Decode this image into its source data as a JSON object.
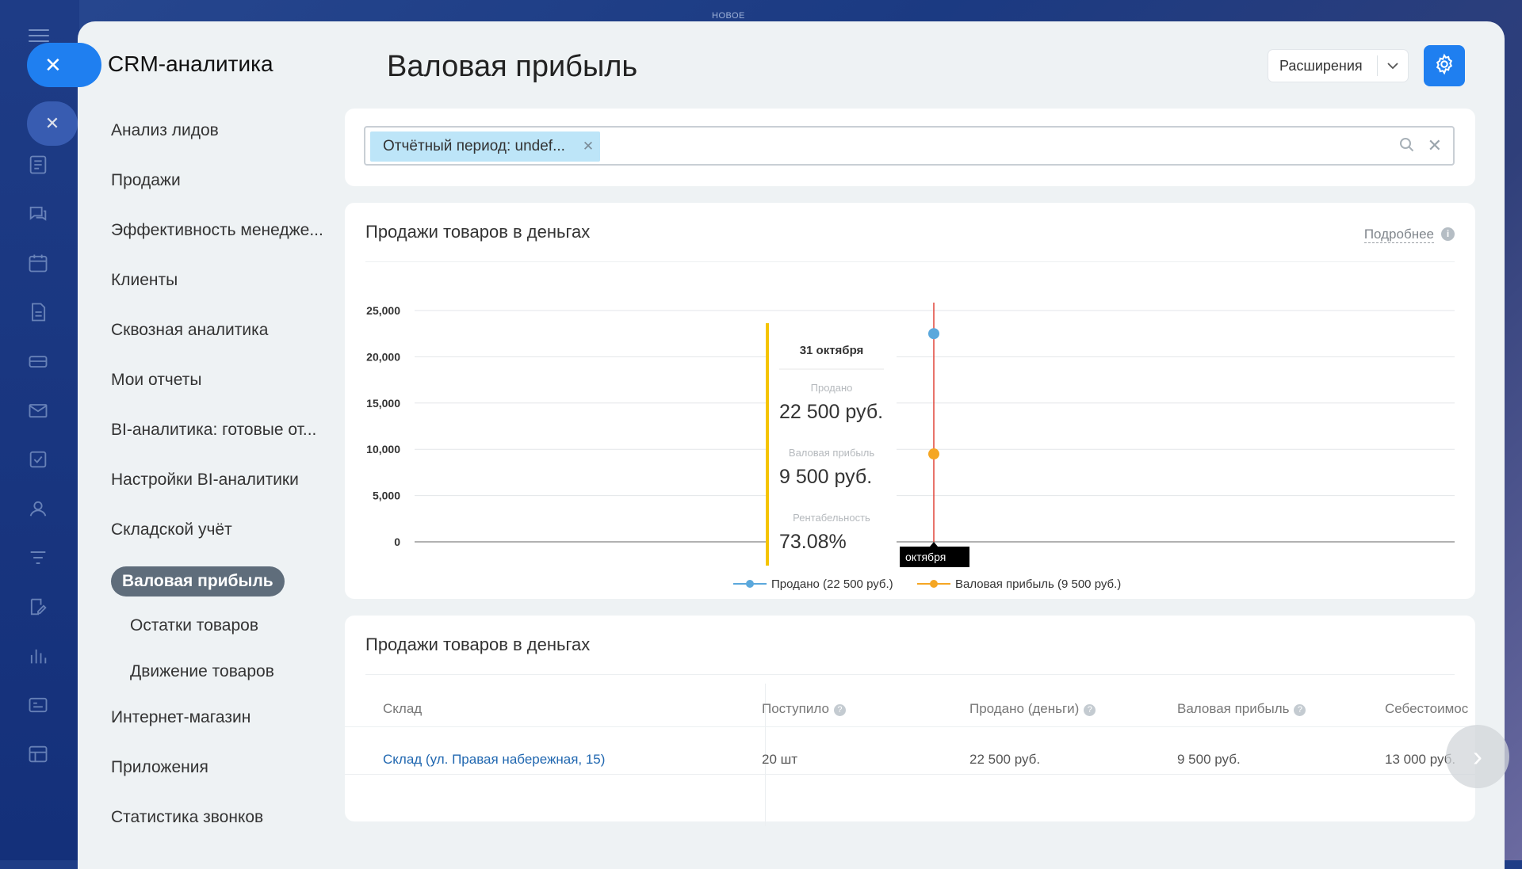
{
  "top_label": "НОВОЕ",
  "sidebar": {
    "title": "CRM-аналитика",
    "items": [
      {
        "label": "Анализ лидов",
        "level": 0
      },
      {
        "label": "Продажи",
        "level": 0
      },
      {
        "label": "Эффективность менедже...",
        "level": 0
      },
      {
        "label": "Клиенты",
        "level": 0
      },
      {
        "label": "Сквозная аналитика",
        "level": 0
      },
      {
        "label": "Мои отчеты",
        "level": 0
      },
      {
        "label": "BI-аналитика: готовые от...",
        "level": 0
      },
      {
        "label": "Настройки BI-аналитики",
        "level": 0
      },
      {
        "label": "Складской учёт",
        "level": 0
      },
      {
        "label": "Валовая прибыль",
        "level": 1,
        "active": true
      },
      {
        "label": "Остатки товаров",
        "level": 1
      },
      {
        "label": "Движение товаров",
        "level": 1
      },
      {
        "label": "Интернет-магазин",
        "level": 0
      },
      {
        "label": "Приложения",
        "level": 0
      },
      {
        "label": "Статистика звонков",
        "level": 0
      }
    ]
  },
  "header": {
    "title": "Валовая прибыль",
    "extensions_label": "Расширения"
  },
  "filter": {
    "chip_label": "Отчётный период: undef..."
  },
  "chart_card": {
    "title": "Продажи товаров в деньгах",
    "more_label": "Подробнее"
  },
  "chart_data": {
    "type": "line",
    "ylim": [
      0,
      25000
    ],
    "yticks": [
      "25,000",
      "20,000",
      "15,000",
      "10,000",
      "5,000",
      "0"
    ],
    "x": [
      "31 октября"
    ],
    "series": [
      {
        "name": "Продано (22 500 руб.)",
        "values": [
          22500
        ],
        "color": "#5ba8dc"
      },
      {
        "name": "Валовая прибыль (9 500 руб.)",
        "values": [
          9500
        ],
        "color": "#f5a623"
      }
    ],
    "cursor_label": "октября",
    "tooltip": {
      "date": "31 октября",
      "rows": [
        {
          "label": "Продано",
          "value": "22 500 руб."
        },
        {
          "label": "Валовая прибыль",
          "value": "9 500 руб."
        },
        {
          "label": "Рентабельность",
          "value": "73.08%"
        }
      ]
    }
  },
  "table": {
    "title": "Продажи товаров в деньгах",
    "headers": [
      "Склад",
      "Поступило",
      "Продано (деньги)",
      "Валовая прибыль",
      "Себестоимос"
    ],
    "rows": [
      [
        "Склад (ул. Правая набережная, 15)",
        "20 шт",
        "22 500 руб.",
        "9 500 руб.",
        "13 000 руб."
      ]
    ]
  },
  "colors": {
    "accent": "#1f7ff0",
    "active_nav": "#5f6d7b",
    "chip": "#bde5f8",
    "cursor_line": "#e0453a",
    "tooltip_bar": "#f5c400"
  }
}
